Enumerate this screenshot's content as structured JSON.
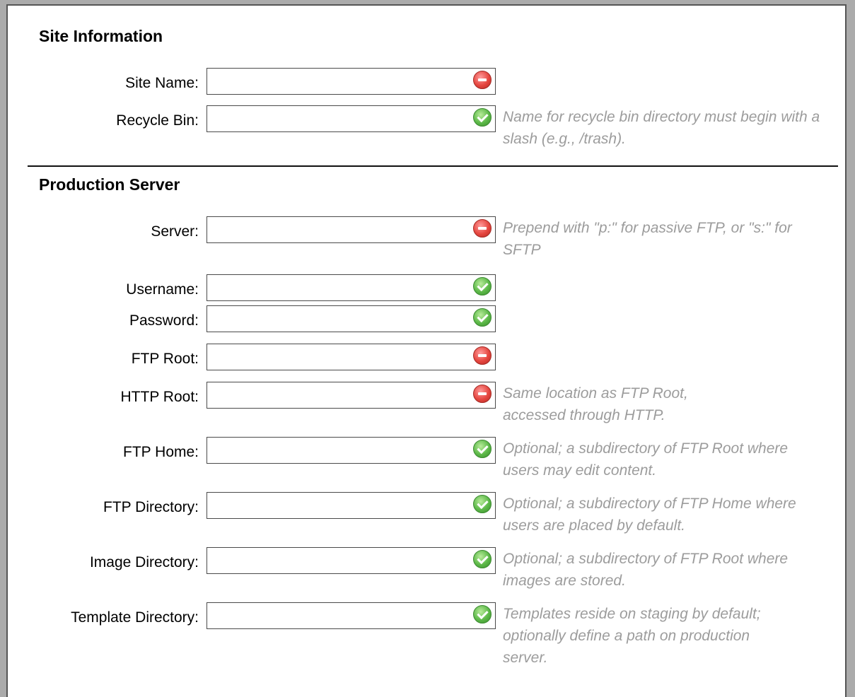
{
  "site_information": {
    "title": "Site Information",
    "fields": [
      {
        "label": "Site Name:",
        "value": "",
        "status": "error",
        "hint": ""
      },
      {
        "label": "Recycle Bin:",
        "value": "",
        "status": "ok",
        "hint": "Name for recycle bin directory must begin with a slash (e.g., /trash)."
      }
    ]
  },
  "production_server": {
    "title": "Production Server",
    "fields": [
      {
        "label": "Server:",
        "value": "",
        "status": "error",
        "hint": "Prepend with \"p:\" for passive FTP, or \"s:\" for SFTP"
      },
      {
        "label": "Username:",
        "value": "",
        "status": "ok",
        "hint": ""
      },
      {
        "label": "Password:",
        "value": "",
        "status": "ok",
        "hint": ""
      },
      {
        "label": "FTP Root:",
        "value": "",
        "status": "error",
        "hint": ""
      },
      {
        "label": "HTTP Root:",
        "value": "",
        "status": "error",
        "hint": "Same location as FTP Root, accessed through HTTP."
      },
      {
        "label": "FTP Home:",
        "value": "",
        "status": "ok",
        "hint": "Optional; a subdirectory of FTP Root where users may edit content."
      },
      {
        "label": "FTP Directory:",
        "value": "",
        "status": "ok",
        "hint": "Optional; a subdirectory of FTP Home where users are placed by default."
      },
      {
        "label": "Image Directory:",
        "value": "",
        "status": "ok",
        "hint": "Optional; a subdirectory of FTP Root where images are stored."
      },
      {
        "label": "Template Directory:",
        "value": "",
        "status": "ok",
        "hint": "Templates reside on staging by default; optionally define a path on production server."
      }
    ]
  },
  "status_icons": {
    "error": "minus-circle-icon",
    "ok": "check-circle-icon"
  },
  "colors": {
    "error": "#e5463f",
    "ok": "#5cb848",
    "hint_text": "#9c9c9c"
  }
}
